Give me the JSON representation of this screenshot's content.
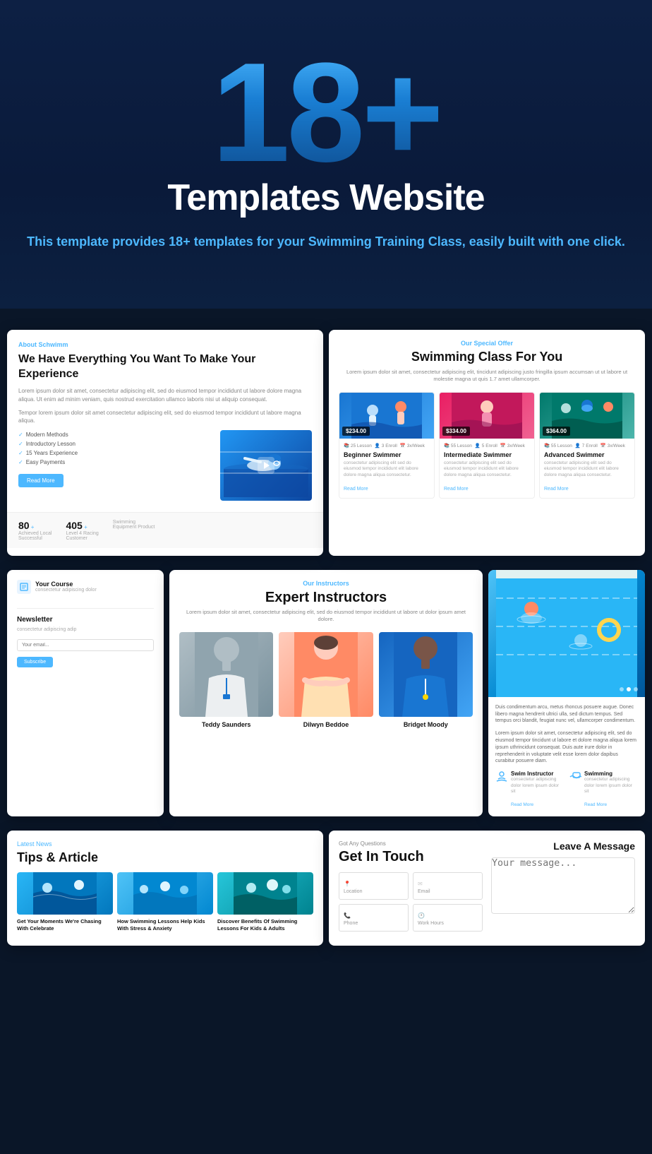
{
  "hero": {
    "number": "18+",
    "title": "Templates Website",
    "description_before": "This template provides ",
    "description_highlight": "18+ templates",
    "description_after": " for your\nSwimming Training Class, easily built with one click."
  },
  "cards": {
    "card1": {
      "tag": "About Schwimm",
      "title": "We Have Everything You Want To Make Your Experience",
      "body_text": "Lorem ipsum dolor sit amet, consectetur adipiscing elit, sed do eiusmod tempor incididunt ut labore dolore magna aliqua. Ut enim ad minim veniam, quis nostrud exercitation ullamco laboris nisi ut aliquip consequat.",
      "extra_text": "Tempor lorem ipsum dolor sit amet consectetur adipiscing elit, sed do eiusmod tempor incididunt ut labore magna aliqua.",
      "list_items": [
        "Modern Methods",
        "Introductory Lesson",
        "15 Years Experience",
        "Easy Payments"
      ],
      "btn_label": "Read More",
      "stats": [
        {
          "label": "Achieved Local\nSuccessful",
          "num": "80",
          "plus": true
        },
        {
          "label": "Level 4 Racing\nCustomer",
          "num": "405",
          "plus": true
        },
        {
          "label": "Swimming\nEquipment Product",
          "num": "",
          "plus": false
        }
      ]
    },
    "card2": {
      "tag": "Our Special Offer",
      "title": "Swimming Class For You",
      "desc": "Lorem ipsum dolor sit amet, consectetur adipiscing elit, tincidunt adipiscing justo fringilla ipsum accumsan ut ut labore ut molestie magna ut quis 1.7 amet ullamcorper.",
      "plans": [
        {
          "price": "$234.00",
          "lessons": "25 Lesson",
          "enroll": "3 Enroll",
          "per_week": "3x/Week",
          "name": "Beginner Swimmer",
          "link": "Read More"
        },
        {
          "price": "$334.00",
          "lessons": "55 Lesson",
          "enroll": "5 Enroll",
          "per_week": "3x/Week",
          "name": "Intermediate Swimmer",
          "link": "Read More"
        },
        {
          "price": "$364.00",
          "lessons": "55 Lesson",
          "enroll": "7 Enroll",
          "per_week": "3x/Week",
          "name": "Advanced Swimmer",
          "link": "Read More"
        }
      ]
    },
    "card3": {
      "course_label": "Your Course",
      "course_sub": "consectetur adipiscing dolor",
      "newsletter": {
        "title": "Newsletter",
        "text": "consectetur adipiscing adip",
        "btn": "Subscribe"
      }
    },
    "card4": {
      "tag": "Our Instructors",
      "title": "Expert Instructors",
      "desc": "Lorem ipsum dolor sit amet, consectetur adipiscing elit, sed do eiusmod tempor incididunt ut\nlabore ut dolor ipsum amet dolore.",
      "instructors": [
        {
          "name": "Teddy Saunders"
        },
        {
          "name": "Dilwyn Beddoe"
        },
        {
          "name": "Bridget Moody"
        }
      ]
    },
    "card5": {
      "body_text": "Duis condimentum arcu, metus rhoncus posuere augue. Donec libero magna hendrerit ultrici ulla, sed dictum tempus. Sed tempus orci blandit, feugiat nunc vel, ullamcorper condimentum.",
      "body_text2": "Lorem ipsum dolor sit amet, consectetur adipiscing elit, sed do eiusmod tempor tincidunt ut labore et dolore magna aliqua lorem ipsum uthrincidunt consequat. Duis aute irure dolor in reprehenderit in voluptate velit esse lorem dolor dapibus curabitur posuere diam.",
      "services": [
        {
          "name": "Swim Instructor",
          "desc": "consectetur adipiscing dolor lorem ipsum dolor sit",
          "link": "Read More"
        },
        {
          "name": "Swimming",
          "desc": "consectetur adipiscing dolor lorem ipsum dolor sit",
          "link": "Read More"
        }
      ]
    },
    "card6": {
      "tag": "Latest News",
      "title": "Tips & Article",
      "articles": [
        {
          "title": "Get Your Moments We're Chasing With Celebrate"
        },
        {
          "title": "How Swimming Lessons Help Kids With Stress & Anxiety"
        },
        {
          "title": "Discover Benefits Of Swimming Lessons For Kids & Adults"
        }
      ]
    },
    "card7": {
      "tag": "Got Any Questions",
      "title": "Get In Touch",
      "right_title": "Leave A Message",
      "fields": [
        {
          "label": "Location",
          "icon": "📍"
        },
        {
          "label": "Email",
          "icon": "✉"
        },
        {
          "label": "Phone",
          "icon": "📞"
        },
        {
          "label": "Work Hours",
          "icon": "🕐"
        }
      ]
    }
  },
  "colors": {
    "accent": "#4db8ff",
    "dark_bg": "#0a1628",
    "white": "#ffffff",
    "text_dark": "#111111",
    "text_gray": "#888888"
  }
}
